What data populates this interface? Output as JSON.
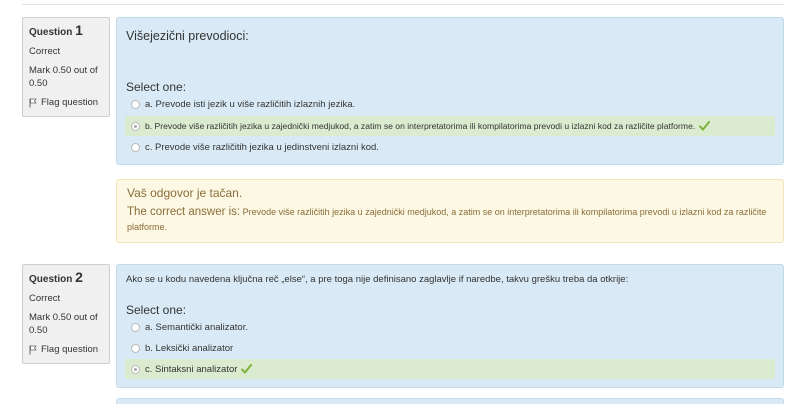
{
  "questions": [
    {
      "label": "Question",
      "number": "1",
      "state": "Correct",
      "grade": "Mark 0.50 out of 0.50",
      "flag": "Flag question",
      "text": "Višejezični prevodioci:",
      "prompt": "Select one:",
      "options": [
        {
          "label": "a. Prevode isti jezik u više različitih izlaznih jezika.",
          "checked": false,
          "correct": false
        },
        {
          "label": "b. Prevode više različitih jezika u zajednički medjukod, a zatim se on interpretatorima ili kompilatorima prevodi u izlazni kod za različite platforme.",
          "checked": true,
          "correct": true
        },
        {
          "label": "c. Prevode više različitih jezika u jedinstveni izlazni kod.",
          "checked": false,
          "correct": false
        }
      ],
      "feedback": {
        "title": "Vaš odgovor je tačan.",
        "lead": "The correct answer is:",
        "answer": "Prevode više različitih jezika u zajednički medjukod, a zatim se on interpretatorima ili kompilatorima prevodi u izlazni kod za različite platforme."
      }
    },
    {
      "label": "Question",
      "number": "2",
      "state": "Correct",
      "grade": "Mark 0.50 out of 0.50",
      "flag": "Flag question",
      "text": "Ako se u kodu navedena ključna reč „else“, a pre toga nije definisano zaglavlje if naredbe, takvu grešku treba da otkrije:",
      "prompt": "Select one:",
      "options": [
        {
          "label": "a. Semantički analizator.",
          "checked": false,
          "correct": false
        },
        {
          "label": "b. Leksički analizator",
          "checked": false,
          "correct": false
        },
        {
          "label": "c. Sintaksni analizator",
          "checked": true,
          "correct": true
        }
      ]
    }
  ],
  "colors": {
    "question_bg": "#d9eaf6",
    "feedback_bg": "#fcf8e3",
    "correct_option_bg": "#dbebcf",
    "check_green": "#7bb33a",
    "info_bg": "#f0f0f0"
  },
  "icons": {
    "flag": "flag-icon",
    "check": "check-icon"
  }
}
